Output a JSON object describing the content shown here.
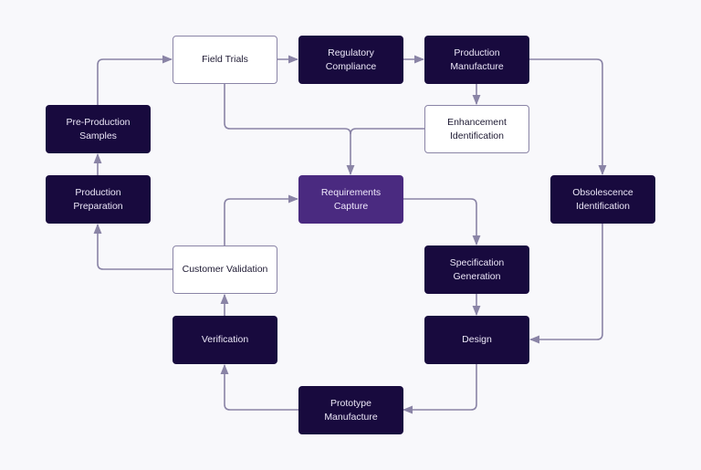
{
  "colors": {
    "background": "#f8f8fb",
    "dark_node": "#180a3e",
    "accent_node": "#4a2a80",
    "light_node": "#ffffff",
    "connector": "#8a84a6"
  },
  "nodes": [
    {
      "id": "field-trials",
      "label": "Field Trials",
      "style": "light"
    },
    {
      "id": "regulatory-compliance",
      "label": "Regulatory Compliance",
      "style": "dark"
    },
    {
      "id": "production-manufacture",
      "label": "Production Manufacture",
      "style": "dark"
    },
    {
      "id": "enhancement-identification",
      "label": "Enhancement Identification",
      "style": "light"
    },
    {
      "id": "pre-production-samples",
      "label": "Pre-Production Samples",
      "style": "dark"
    },
    {
      "id": "production-preparation",
      "label": "Production Preparation",
      "style": "dark"
    },
    {
      "id": "requirements-capture",
      "label": "Requirements Capture",
      "style": "accent"
    },
    {
      "id": "obsolescence-identification",
      "label": "Obsolescence Identification",
      "style": "dark"
    },
    {
      "id": "customer-validation",
      "label": "Customer Validation",
      "style": "light"
    },
    {
      "id": "specification-generation",
      "label": "Specification Generation",
      "style": "dark"
    },
    {
      "id": "verification",
      "label": "Verification",
      "style": "dark"
    },
    {
      "id": "design",
      "label": "Design",
      "style": "dark"
    },
    {
      "id": "prototype-manufacture",
      "label": "Prototype Manufacture",
      "style": "dark"
    }
  ],
  "edges": [
    {
      "from": "pre-production-samples",
      "to": "field-trials"
    },
    {
      "from": "field-trials",
      "to": "regulatory-compliance"
    },
    {
      "from": "regulatory-compliance",
      "to": "production-manufacture"
    },
    {
      "from": "production-manufacture",
      "to": "obsolescence-identification"
    },
    {
      "from": "production-manufacture",
      "to": "enhancement-identification"
    },
    {
      "from": "field-trials",
      "to": "requirements-capture"
    },
    {
      "from": "enhancement-identification",
      "to": "requirements-capture"
    },
    {
      "from": "requirements-capture",
      "to": "specification-generation"
    },
    {
      "from": "specification-generation",
      "to": "design"
    },
    {
      "from": "obsolescence-identification",
      "to": "design"
    },
    {
      "from": "design",
      "to": "prototype-manufacture"
    },
    {
      "from": "prototype-manufacture",
      "to": "verification"
    },
    {
      "from": "verification",
      "to": "customer-validation"
    },
    {
      "from": "customer-validation",
      "to": "requirements-capture"
    },
    {
      "from": "customer-validation",
      "to": "production-preparation"
    },
    {
      "from": "production-preparation",
      "to": "pre-production-samples"
    }
  ]
}
